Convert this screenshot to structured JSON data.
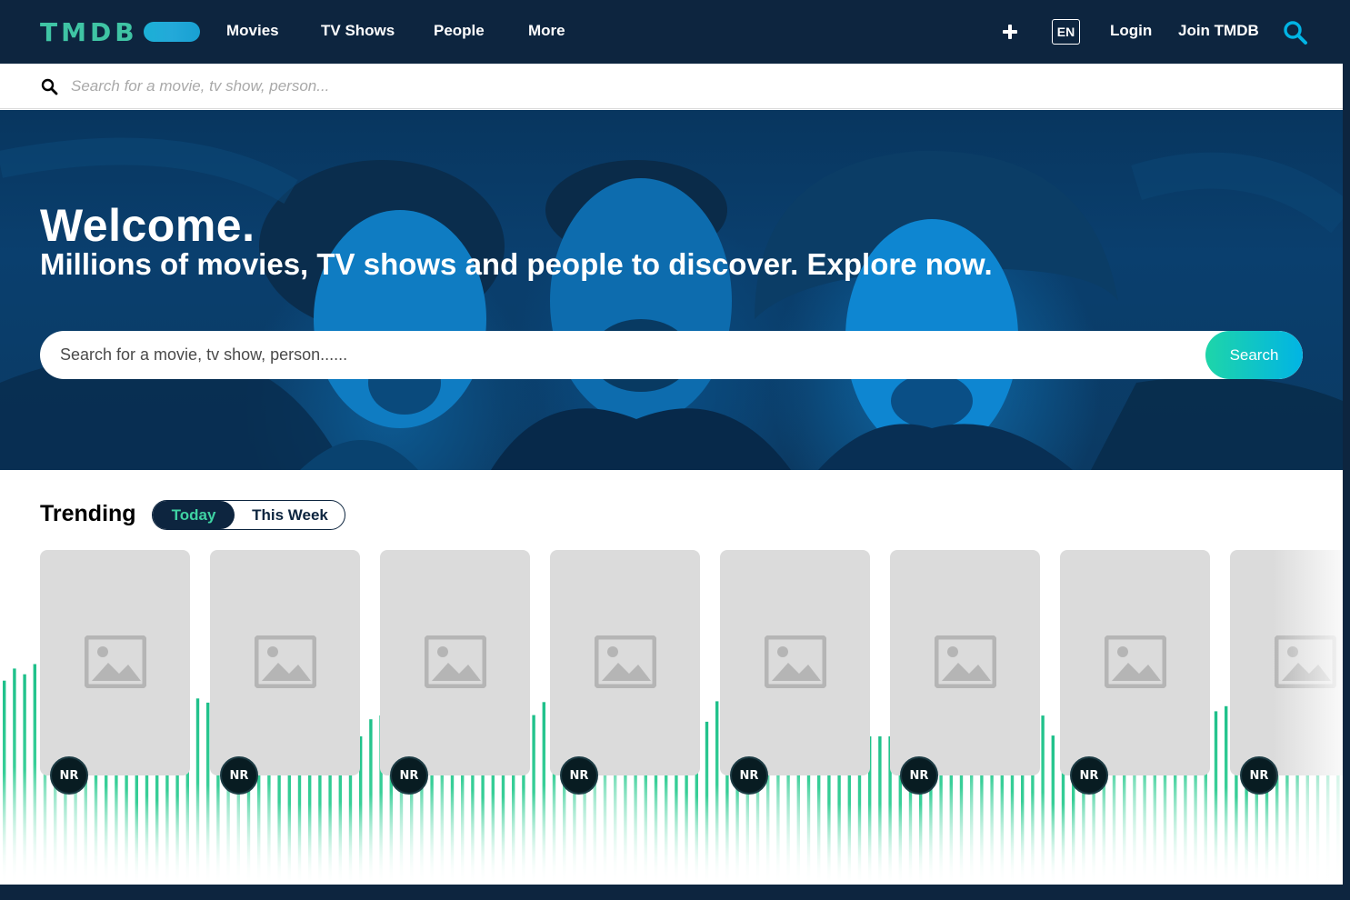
{
  "brand": {
    "logo_text": "TMDB"
  },
  "nav": {
    "items": [
      {
        "label": "Movies"
      },
      {
        "label": "TV Shows"
      },
      {
        "label": "People"
      },
      {
        "label": "More"
      }
    ],
    "language": "EN",
    "login": "Login",
    "join": "Join TMDB",
    "icons": [
      "plus-icon",
      "search-icon"
    ]
  },
  "top_search": {
    "placeholder": "Search for a movie, tv show, person..."
  },
  "hero": {
    "title": "Welcome.",
    "subtitle": "Millions of movies, TV shows and people to discover. Explore now.",
    "search_placeholder": "Search for a movie, tv show, person......",
    "search_button": "Search"
  },
  "trending": {
    "title": "Trending",
    "tabs": [
      {
        "label": "Today",
        "active": true
      },
      {
        "label": "This Week",
        "active": false
      }
    ],
    "cards": [
      {
        "rating": "NR"
      },
      {
        "rating": "NR"
      },
      {
        "rating": "NR"
      },
      {
        "rating": "NR"
      },
      {
        "rating": "NR"
      },
      {
        "rating": "NR"
      },
      {
        "rating": "NR"
      },
      {
        "rating": "NR"
      }
    ]
  },
  "colors": {
    "navy": "#0d253f",
    "green": "#3fc4a4",
    "blue": "#01b4e4",
    "badge": "#081c22",
    "placeholder_gray": "#dbdbdb"
  }
}
